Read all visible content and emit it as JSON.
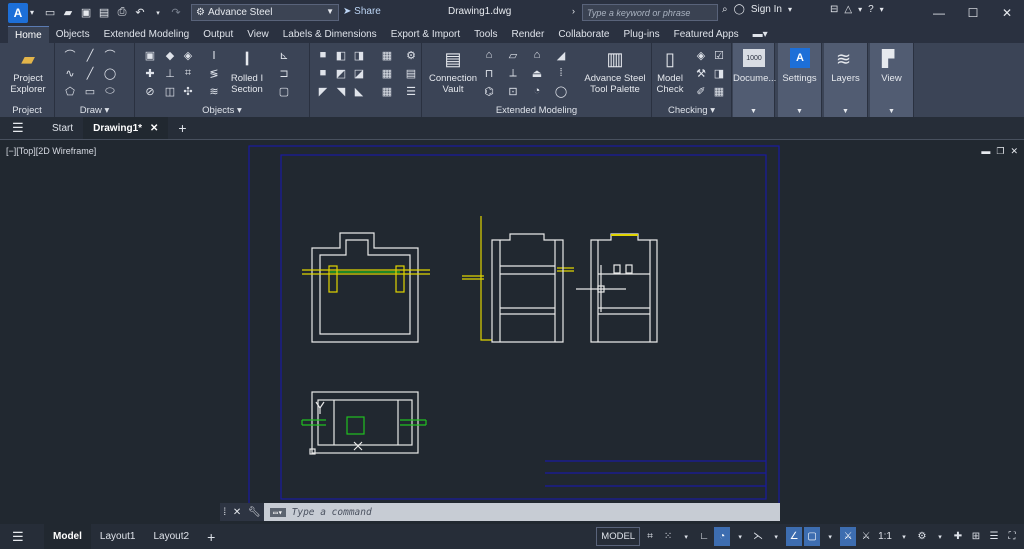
{
  "titlebar": {
    "app_letter": "A",
    "workspace": "Advance Steel",
    "share": "Share",
    "document": "Drawing1.dwg",
    "search_placeholder": "Type a keyword or phrase",
    "signin": "Sign In"
  },
  "ribbon_tabs": [
    "Home",
    "Objects",
    "Extended Modeling",
    "Output",
    "View",
    "Labels & Dimensions",
    "Export & Import",
    "Tools",
    "Render",
    "Collaborate",
    "Plug-ins",
    "Featured Apps"
  ],
  "panels": {
    "project": {
      "title": "Project",
      "tool": "Project Explorer"
    },
    "draw": {
      "title": "Draw"
    },
    "objects": {
      "title": "Objects",
      "tool": "Rolled I Section"
    },
    "extended": {
      "title": "Extended Modeling",
      "tool1": "Connection Vault",
      "tool2": "Advance Steel Tool Palette"
    },
    "checking": {
      "title": "Checking",
      "tool": "Model Check"
    },
    "documents": {
      "label": "Docume...",
      "badge": "1000"
    },
    "settings": {
      "label": "Settings"
    },
    "layers": {
      "label": "Layers"
    },
    "view": {
      "label": "View"
    }
  },
  "doc_tabs": {
    "start": "Start",
    "drawing": "Drawing1*"
  },
  "viewport": {
    "label": "[−][Top][2D Wireframe]"
  },
  "command": {
    "placeholder": "Type a command"
  },
  "status": {
    "tabs": [
      "Model",
      "Layout1",
      "Layout2"
    ],
    "model_btn": "MODEL",
    "scale": "1:1"
  },
  "colors": {
    "accent": "#1d6fd8",
    "frame": "#1a1aa0",
    "drawing": "#e8e8e8",
    "yellow": "#e0d400",
    "green": "#20c020"
  }
}
